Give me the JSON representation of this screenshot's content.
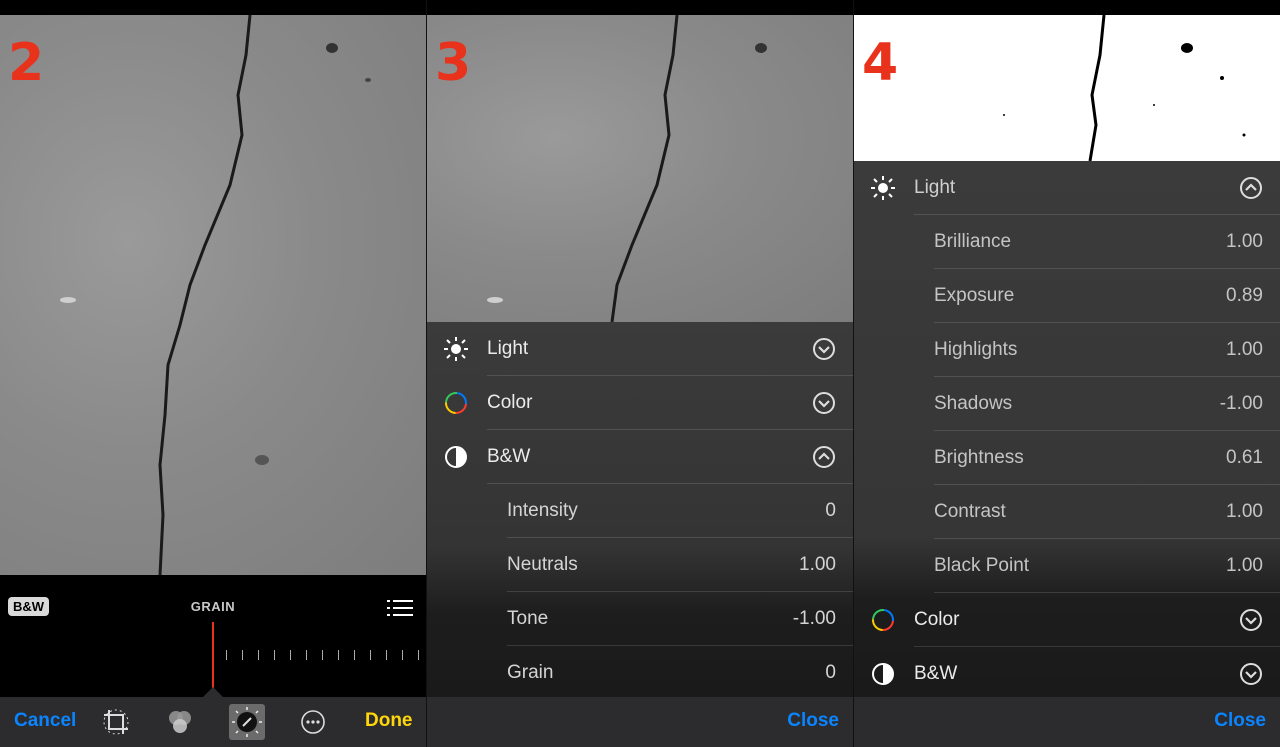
{
  "panel2": {
    "step": "2",
    "badge": "B&W",
    "slider_label": "GRAIN",
    "toolbar": {
      "cancel": "Cancel",
      "done": "Done"
    },
    "icons": [
      "crop-icon",
      "filters-icon",
      "adjust-icon",
      "more-icon",
      "list-icon"
    ]
  },
  "panel3": {
    "step": "3",
    "sections": [
      {
        "label": "Light",
        "expanded": false
      },
      {
        "label": "Color",
        "expanded": false
      },
      {
        "label": "B&W",
        "expanded": true
      }
    ],
    "bw_items": [
      {
        "label": "Intensity",
        "value": "0"
      },
      {
        "label": "Neutrals",
        "value": "1.00"
      },
      {
        "label": "Tone",
        "value": "-1.00"
      },
      {
        "label": "Grain",
        "value": "0"
      }
    ],
    "close": "Close"
  },
  "panel4": {
    "step": "4",
    "light_section": {
      "label": "Light",
      "expanded": true
    },
    "light_items": [
      {
        "label": "Brilliance",
        "value": "1.00"
      },
      {
        "label": "Exposure",
        "value": "0.89"
      },
      {
        "label": "Highlights",
        "value": "1.00"
      },
      {
        "label": "Shadows",
        "value": "-1.00"
      },
      {
        "label": "Brightness",
        "value": "0.61"
      },
      {
        "label": "Contrast",
        "value": "1.00"
      },
      {
        "label": "Black Point",
        "value": "1.00"
      }
    ],
    "other_sections": [
      {
        "label": "Color",
        "expanded": false
      },
      {
        "label": "B&W",
        "expanded": false
      }
    ],
    "close": "Close"
  },
  "colors": {
    "accent_blue": "#0a84ff",
    "done_yellow": "#ffd60a",
    "step_red": "#e8321c",
    "slider_red": "#e8321c"
  }
}
